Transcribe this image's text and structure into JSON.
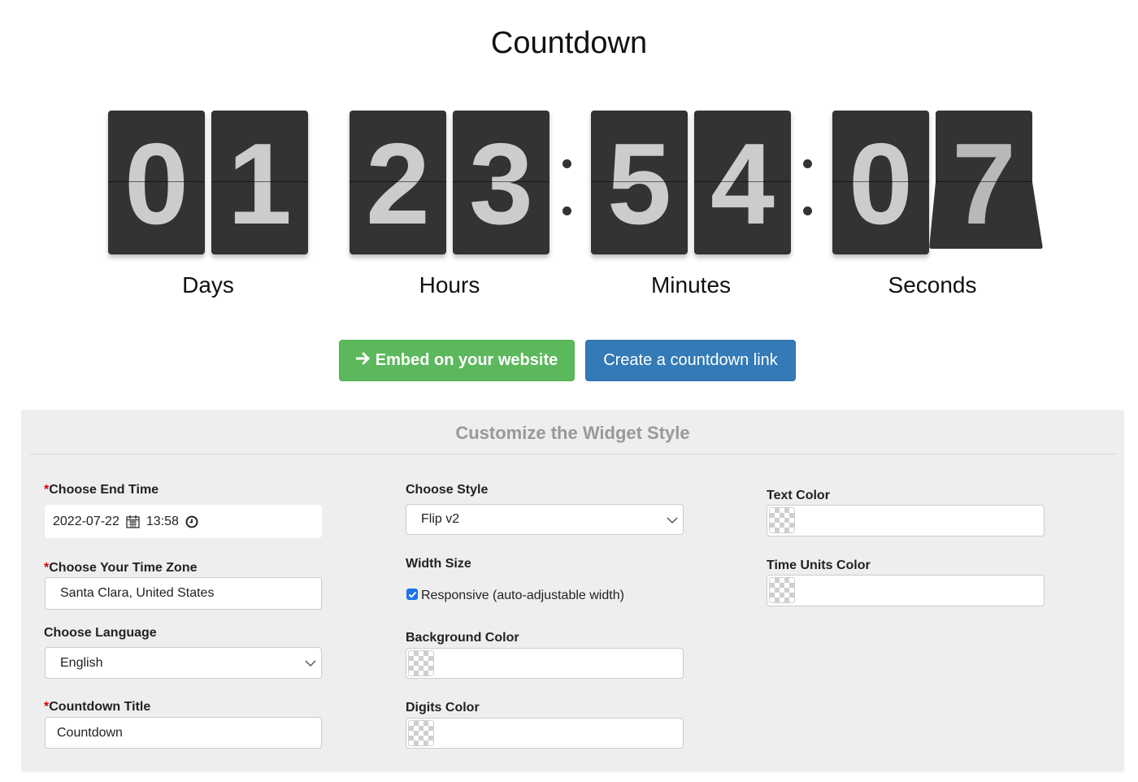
{
  "header": {
    "title": "Countdown"
  },
  "countdown": {
    "groups": [
      {
        "name": "days",
        "digits": [
          "0",
          "1"
        ],
        "label": "Days"
      },
      {
        "name": "hours",
        "digits": [
          "2",
          "3"
        ],
        "label": "Hours"
      },
      {
        "name": "minutes",
        "digits": [
          "5",
          "4"
        ],
        "label": "Minutes"
      },
      {
        "name": "seconds",
        "digits": [
          "0",
          "7"
        ],
        "label": "Seconds"
      }
    ],
    "separator_icon": "colon-dots"
  },
  "actions": {
    "embed_label": "Embed on your website",
    "embed_icon": "arrow-right-icon",
    "link_label": "Create a countdown link",
    "colors": {
      "embed": "#5cb85c",
      "link": "#337ab7"
    }
  },
  "customize": {
    "title": "Customize the Widget Style",
    "end_time": {
      "required_mark": "*",
      "label": "Choose End Time",
      "date": "2022-07-22",
      "time": "13:58"
    },
    "time_zone": {
      "required_mark": "*",
      "label": "Choose Your Time Zone",
      "value": "Santa Clara, United States"
    },
    "language": {
      "label": "Choose Language",
      "value": "English"
    },
    "countdown_title": {
      "required_mark": "*",
      "label": "Countdown Title",
      "value": "Countdown"
    },
    "style": {
      "label": "Choose Style",
      "value": "Flip v2"
    },
    "width_size": {
      "label": "Width Size",
      "responsive_label": "Responsive (auto-adjustable width)",
      "responsive_checked": true
    },
    "background_color": {
      "label": "Background Color",
      "value": ""
    },
    "digits_color": {
      "label": "Digits Color",
      "value": ""
    },
    "text_color": {
      "label": "Text Color",
      "value": ""
    },
    "time_units_color": {
      "label": "Time Units Color",
      "value": ""
    }
  }
}
